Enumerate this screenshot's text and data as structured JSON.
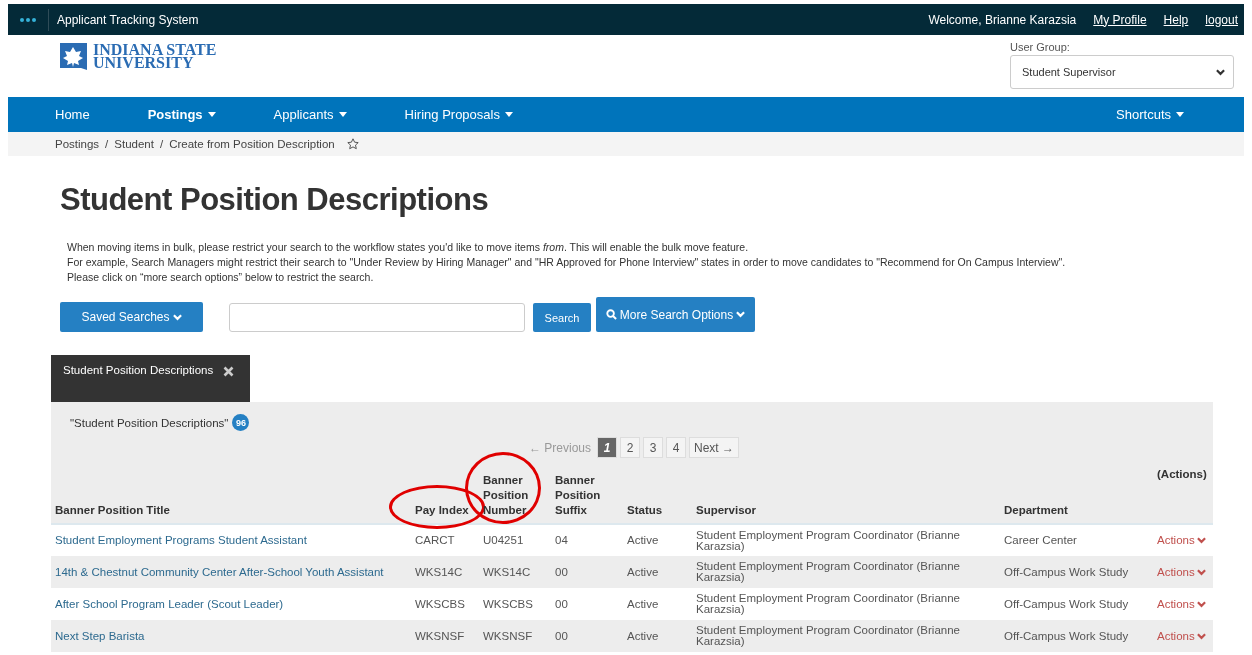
{
  "top_bar": {
    "app_title": "Applicant Tracking System",
    "welcome": "Welcome, Brianne Karazsia",
    "links": [
      "My Profile",
      "Help",
      "logout"
    ]
  },
  "logo": {
    "lines": [
      "INDIANA STATE",
      "UNIVERSITY"
    ]
  },
  "user_group": {
    "label": "User Group:",
    "value": "Student Supervisor"
  },
  "nav": {
    "items": [
      {
        "label": "Home",
        "dropdown": false,
        "selected": false
      },
      {
        "label": "Postings",
        "dropdown": true,
        "selected": true
      },
      {
        "label": "Applicants",
        "dropdown": true,
        "selected": false
      },
      {
        "label": "Hiring Proposals",
        "dropdown": true,
        "selected": false
      }
    ],
    "shortcuts": "Shortcuts"
  },
  "breadcrumb": {
    "separator": "/",
    "items": [
      "Postings",
      "Student",
      "Create from Position Description"
    ]
  },
  "title": "Student Position Descriptions",
  "intro": [
    "When moving items in bulk, please restrict your search to the workflow states you'd like to move items *from*.  This will enable the bulk move feature.",
    "For example, Search Managers might restrict their search to \"Under Review by Hiring Manager\" and \"HR Approved for Phone Interview\" states in order to move candidates to \"Recommend for On Campus Interview\".",
    "Please click on “more search options” below to restrict the search."
  ],
  "search": {
    "saved": "Saved Searches",
    "button": "Search",
    "more": "More Search Options"
  },
  "result_tab": {
    "label": "Student Position Descriptions"
  },
  "results": {
    "label": "\"Student Position Descriptions\"",
    "count": "96"
  },
  "pagination": {
    "previous": "← Previous",
    "next": "Next →",
    "pages": [
      {
        "label": "1",
        "selected": true
      },
      {
        "label": "2",
        "selected": false
      },
      {
        "label": "3",
        "selected": false
      },
      {
        "label": "4",
        "selected": false
      }
    ]
  },
  "table": {
    "actions_header": "(Actions)",
    "columns": [
      {
        "label": "Banner Position Title",
        "circled": false
      },
      {
        "label": "Pay Index",
        "circled": true
      },
      {
        "label": "Banner Position Number",
        "circled": true
      },
      {
        "label": "Banner Position Suffix",
        "circled": false
      },
      {
        "label": "Status",
        "circled": false
      },
      {
        "label": "Supervisor",
        "circled": false
      },
      {
        "label": "Department",
        "circled": false
      }
    ],
    "rows": [
      {
        "cells": [
          "Student Employment Programs Student Assistant",
          "CARCT",
          "U04251",
          "04",
          "Active",
          "Student Employment Program Coordinator (Brianne Karazsia)",
          "Career Center"
        ],
        "action": "Actions"
      },
      {
        "cells": [
          "14th & Chestnut Community Center After-School Youth Assistant",
          "WKS14C",
          "WKS14C",
          "00",
          "Active",
          "Student Employment Program Coordinator (Brianne Karazsia)",
          "Off-Campus Work Study"
        ],
        "action": "Actions"
      },
      {
        "cells": [
          "After School Program Leader (Scout Leader)",
          "WKSCBS",
          "WKSCBS",
          "00",
          "Active",
          "Student Employment Program Coordinator (Brianne Karazsia)",
          "Off-Campus Work Study"
        ],
        "action": "Actions"
      },
      {
        "cells": [
          "Next Step Barista",
          "WKSNSF",
          "WKSNSF",
          "00",
          "Active",
          "Student Employment Program Coordinator (Brianne Karazsia)",
          "Off-Campus Work Study"
        ],
        "action": "Actions"
      }
    ]
  }
}
